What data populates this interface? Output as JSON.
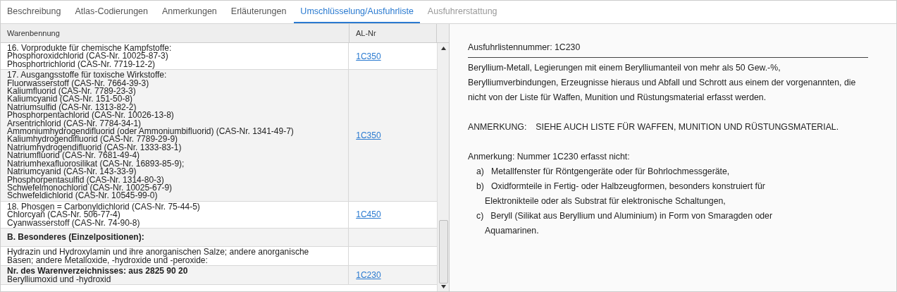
{
  "tabs": [
    {
      "label": "Beschreibung",
      "selected": false,
      "disabled": false
    },
    {
      "label": "Atlas-Codierungen",
      "selected": false,
      "disabled": false
    },
    {
      "label": "Anmerkungen",
      "selected": false,
      "disabled": false
    },
    {
      "label": "Erläuterungen",
      "selected": false,
      "disabled": false
    },
    {
      "label": "Umschlüsselung/Ausfuhrliste",
      "selected": true,
      "disabled": false
    },
    {
      "label": "Ausfuhrerstattung",
      "selected": false,
      "disabled": true
    }
  ],
  "table": {
    "columns": [
      "Warenbennung",
      "AL-Nr"
    ],
    "rows": [
      {
        "kind": "item",
        "lines": [
          "16. Vorprodukte für chemische Kampfstoffe:",
          "Phosphoroxidchlorid (CAS-Nr. 10025-87-3)",
          "Phosphortrichlorid (CAS-Nr. 7719-12-2)"
        ],
        "al_nr": "1C350"
      },
      {
        "kind": "item",
        "lines": [
          "17. Ausgangsstoffe für toxische Wirkstoffe:",
          "Fluorwasserstoff (CAS-Nr. 7664-39-3)",
          "Kaliumfluorid (CAS-Nr. 7789-23-3)",
          "Kaliumcyanid (CAS-Nr. 151-50-8)",
          "Natriumsulfid (CAS-Nr. 1313-82-2)",
          "Phosphorpentachlorid (CAS-Nr. 10026-13-8)",
          "Arsentrichlorid (CAS-Nr. 7784-34-1)",
          "Ammoniumhydrogendifluorid (oder Ammoniumbifluorid) (CAS-Nr. 1341-49-7)",
          "Kaliumhydrogendifluorid (CAS-Nr. 7789-29-9)",
          "Natriumhydrogendifluorid (CAS-Nr. 1333-83-1)",
          "Natriumfluorid (CAS-Nr. 7681-49-4)",
          "Natriumhexafluorosilikat (CAS-Nr. 16893-85-9);",
          "Natriumcyanid (CAS-Nr. 143-33-9)",
          "Phosphorpentasulfid (CAS-Nr. 1314-80-3)",
          "Schwefelmonochlorid (CAS-Nr. 10025-67-9)",
          "Schwefeldichlorid (CAS-Nr. 10545-99-0)"
        ],
        "al_nr": "1C350"
      },
      {
        "kind": "item",
        "lines": [
          "18. Phosgen = Carbonyldichlorid (CAS-Nr. 75-44-5)",
          "Chlorcyan (CAS-Nr. 506-77-4)",
          "Cyanwasserstoff (CAS-Nr. 74-90-8)"
        ],
        "al_nr": "1C450"
      },
      {
        "kind": "heading",
        "lines": [
          "B. Besonderes (Einzelpositionen):"
        ]
      },
      {
        "kind": "item",
        "lines": [
          "Hydrazin und Hydroxylamin und ihre anorganischen Salze; andere anorganische",
          "Basen; andere Metalloxide, -hydroxide und -peroxide:"
        ]
      },
      {
        "kind": "item",
        "lines": [
          "**Nr. des Warenverzeichnisses: aus 2825 90 20**",
          "Berylliumoxid und -hydroxid"
        ],
        "al_nr": "1C230"
      }
    ]
  },
  "detail": {
    "heading": "Ausfuhrlistennummer: 1C230",
    "description": "Beryllium-Metall, Legierungen mit einem Berylliumanteil von mehr als 50 Gew.-%, Berylliumverbindungen, Erzeugnisse hieraus und Abfall und Schrott aus einem der vorgenannten, die nicht von der Liste für Waffen, Munition und Rüstungsmaterial erfasst werden.",
    "remark": {
      "label": "ANMERKUNG:",
      "text": "SIEHE AUCH LISTE FÜR WAFFEN, MUNITION UND RÜSTUNGSMATERIAL."
    },
    "note": {
      "lead": "Anmerkung: Nummer 1C230 erfasst nicht:",
      "items": [
        {
          "marker": "a)",
          "text": "Metallfenster für Röntgengeräte oder für Bohrlochmessgeräte,"
        },
        {
          "marker": "b)",
          "text": "Oxidformteile in Fertig- oder Halbzeugformen, besonders konstruiert für Elektronikteile oder als Substrat für elektronische Schaltungen,"
        },
        {
          "marker": "c)",
          "text": "Beryll (Silikat aus Beryllium und Aluminium) in Form von Smaragden oder Aquamarinen."
        }
      ]
    }
  }
}
